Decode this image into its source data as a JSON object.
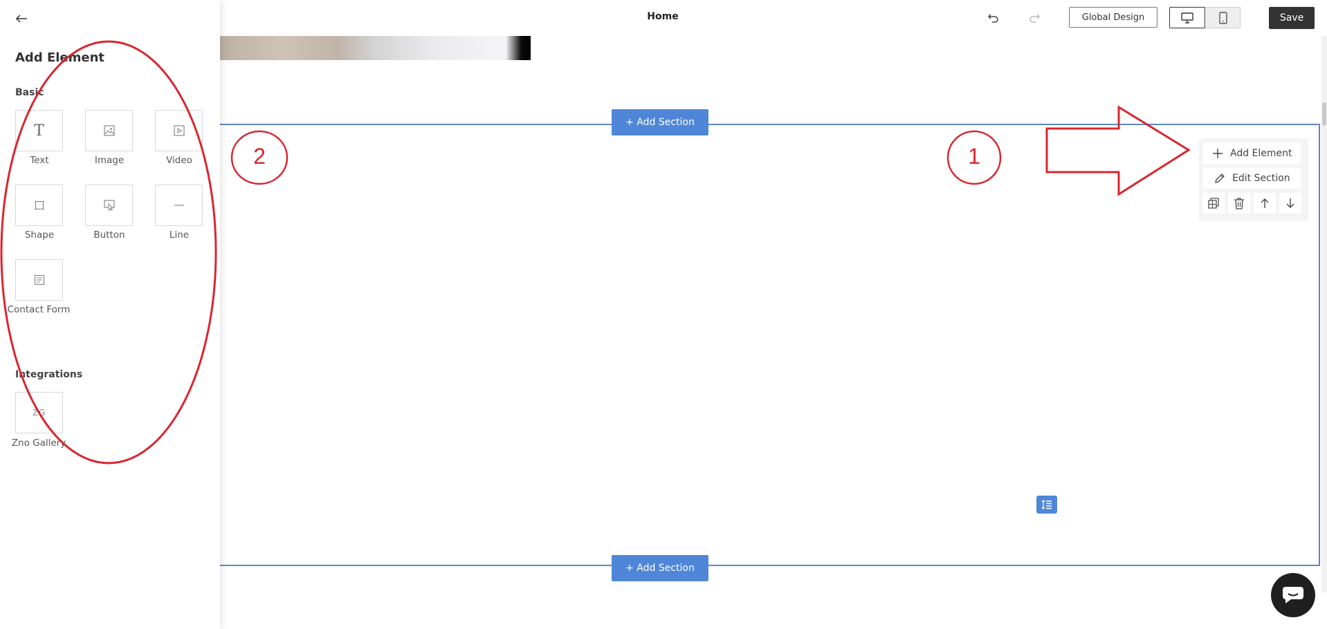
{
  "header": {
    "page_title": "Home",
    "global_design_label": "Global Design",
    "save_label": "Save"
  },
  "sidebar": {
    "title": "Add Element",
    "basic": {
      "heading": "Basic",
      "items": [
        {
          "label": "Text",
          "icon": "text-icon"
        },
        {
          "label": "Image",
          "icon": "image-icon"
        },
        {
          "label": "Video",
          "icon": "video-icon"
        },
        {
          "label": "Shape",
          "icon": "shape-icon"
        },
        {
          "label": "Button",
          "icon": "button-icon"
        },
        {
          "label": "Line",
          "icon": "line-icon"
        },
        {
          "label": "Contact Form",
          "icon": "contact-form-icon"
        }
      ]
    },
    "integrations": {
      "heading": "Integrations",
      "items": [
        {
          "label": "Zno Gallery",
          "icon_text": "ZG"
        }
      ]
    }
  },
  "canvas": {
    "add_section_label": "+ Add Section",
    "section_tools": {
      "add_element_label": "Add Element",
      "edit_section_label": "Edit Section"
    }
  },
  "annotations": {
    "label_1": "1",
    "label_2": "2",
    "color": "#d9252f"
  },
  "colors": {
    "accent": "#4f86d8",
    "save": "#333333"
  }
}
